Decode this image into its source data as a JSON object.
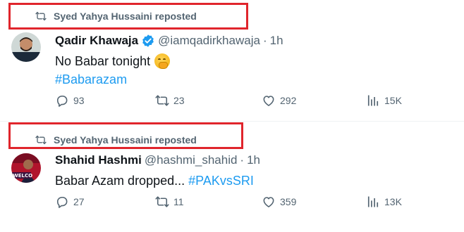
{
  "posts": [
    {
      "reposted_by": "Syed Yahya Hussaini reposted",
      "author_name": "Qadir Khawaja",
      "verified": true,
      "handle": "@iamqadirkhawaja",
      "time": "1h",
      "text": "No Babar tonight",
      "emoji": "face-with-hand-over-mouth",
      "hashtag": "#Babarazam",
      "replies": "93",
      "reposts": "23",
      "likes": "292",
      "views": "15K"
    },
    {
      "reposted_by": "Syed Yahya Hussaini reposted",
      "author_name": "Shahid Hashmi",
      "verified": false,
      "handle": "@hashmi_shahid",
      "time": "1h",
      "text": "Babar Azam dropped...",
      "hashtag": "#PAKvsSRI",
      "replies": "27",
      "reposts": "11",
      "likes": "359",
      "views": "13K"
    }
  ],
  "separator": "·",
  "colors": {
    "highlight": "#e0252c",
    "link": "#1d9bf0",
    "muted": "#536471",
    "verified": "#1d9bf0"
  }
}
